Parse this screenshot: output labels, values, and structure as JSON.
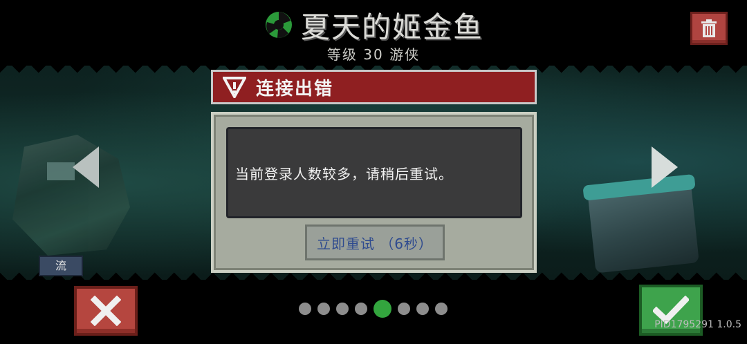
{
  "header": {
    "hero_name": "夏天的姬金鱼",
    "level_label": "等级",
    "level_value": "30",
    "class_name": "游侠",
    "class_icon": "ranger-emblem-icon",
    "delete_icon": "trash-icon"
  },
  "carousel": {
    "prev_icon": "arrow-left-icon",
    "next_icon": "arrow-right-icon",
    "side_tag": "流",
    "page_count": 8,
    "active_page": 5
  },
  "dialog": {
    "title": "连接出错",
    "title_icon": "warning-icon",
    "message": "当前登录人数较多，请稍后重试。",
    "retry_label": "立即重试",
    "retry_countdown": "（6秒）"
  },
  "footer": {
    "cancel_icon": "close-icon",
    "confirm_icon": "check-icon",
    "build_info": "PID1795291 1.0.5"
  },
  "colors": {
    "dialog_header": "#8f1f21",
    "dialog_body": "#a6ab9f",
    "cancel": "#b5463f",
    "confirm": "#3ea34c",
    "active_dot": "#33a53e"
  }
}
